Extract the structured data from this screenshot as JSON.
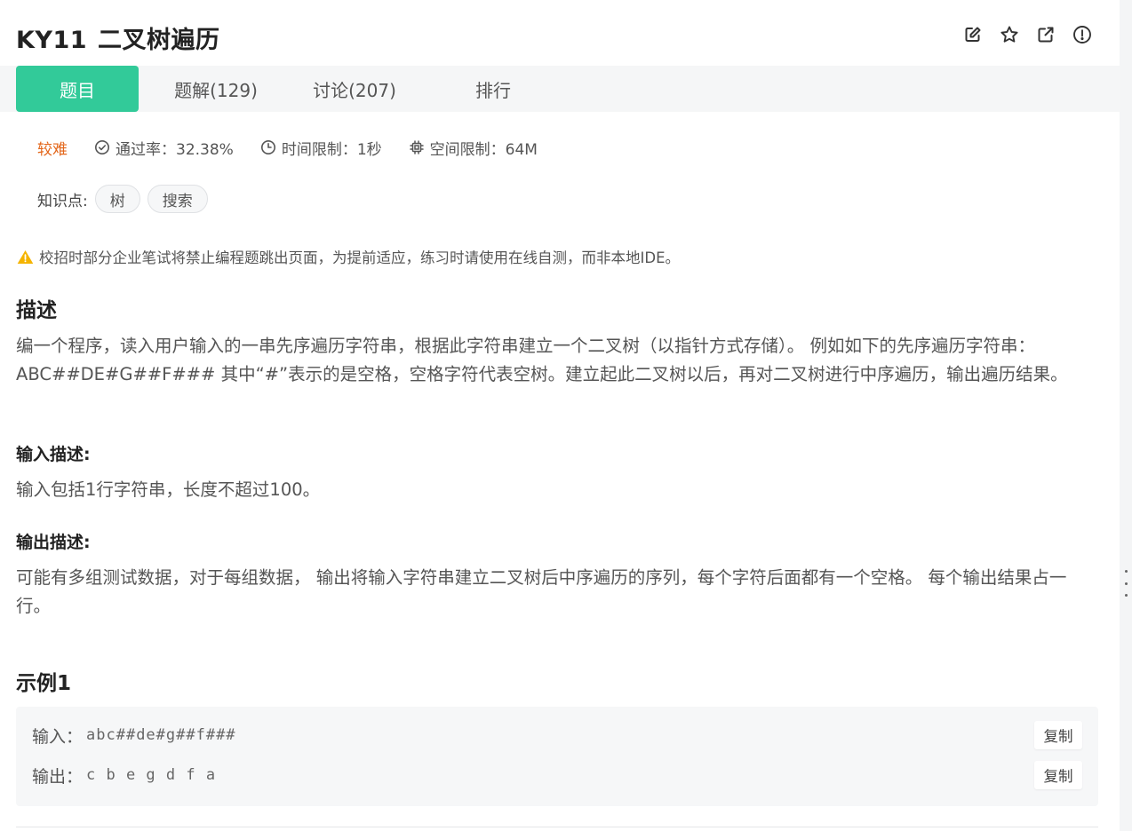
{
  "header": {
    "problem_id": "KY11",
    "problem_name": "二叉树遍历",
    "icons": [
      "edit-icon",
      "star-icon",
      "external-link-icon",
      "info-icon"
    ]
  },
  "tabs": [
    {
      "label": "题目",
      "active": true
    },
    {
      "label": "题解(129)",
      "active": false
    },
    {
      "label": "讨论(207)",
      "active": false
    },
    {
      "label": "排行",
      "active": false
    }
  ],
  "meta": {
    "difficulty": "较难",
    "pass_rate": "通过率：32.38%",
    "time_limit": "时间限制：1秒",
    "memory_limit": "空间限制：64M"
  },
  "knowledge": {
    "label": "知识点:",
    "tags": [
      "树",
      "搜索"
    ]
  },
  "warning": "校招时部分企业笔试将禁止编程题跳出页面，为提前适应，练习时请使用在线自测，而非本地IDE。",
  "description": {
    "heading": "描述",
    "text": "编一个程序，读入用户输入的一串先序遍历字符串，根据此字符串建立一个二叉树（以指针方式存储）。 例如如下的先序遍历字符串： ABC##DE#G##F### 其中“#”表示的是空格，空格字符代表空树。建立起此二叉树以后，再对二叉树进行中序遍历，输出遍历结果。"
  },
  "input_desc": {
    "heading": "输入描述:",
    "text": "输入包括1行字符串，长度不超过100。"
  },
  "output_desc": {
    "heading": "输出描述:",
    "text": "可能有多组测试数据，对于每组数据， 输出将输入字符串建立二叉树后中序遍历的序列，每个字符后面都有一个空格。 每个输出结果占一行。"
  },
  "example": {
    "heading": "示例1",
    "input_label": "输入：",
    "input_value": "abc##de#g##f###",
    "output_label": "输出：",
    "output_value": "c b e g d f a",
    "copy_label": "复制"
  },
  "colors": {
    "accent": "#32ca99",
    "difficulty": "#e3661a",
    "warning_icon": "#f5b400"
  }
}
